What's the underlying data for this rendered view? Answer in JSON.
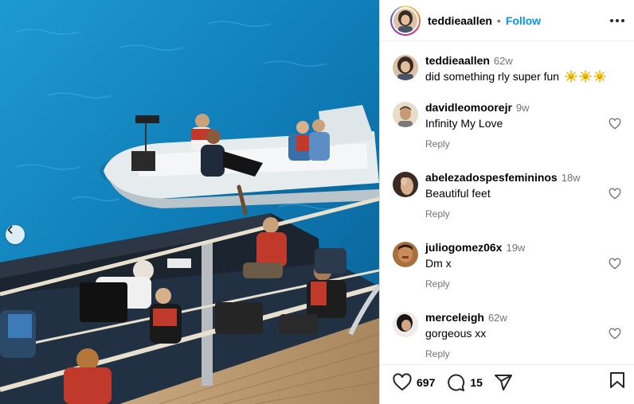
{
  "post": {
    "author": "teddieaallen",
    "follow_label": "Follow",
    "separator": "•",
    "caption": {
      "username": "teddieaallen",
      "time": "62w",
      "text": "did something rly super fun",
      "emoji": [
        "sun-with-face",
        "sun-with-face",
        "sun-with-face"
      ]
    }
  },
  "comments": [
    {
      "username": "davidleomoorejr",
      "time": "9w",
      "text": "Infinity My Love",
      "reply_label": "Reply"
    },
    {
      "username": "abelezadospesfemininos",
      "time": "18w",
      "text": "Beautiful feet",
      "reply_label": "Reply"
    },
    {
      "username": "juliogomez06x",
      "time": "19w",
      "text": "Dm x",
      "reply_label": "Reply"
    },
    {
      "username": "merceleigh",
      "time": "62w",
      "text": "gorgeous xx",
      "reply_label": "Reply"
    }
  ],
  "actions": {
    "likes": "697",
    "comments": "15"
  },
  "icons": {
    "carousel_prev": "chevron-left-icon",
    "more": "more-horizontal-icon",
    "like": "heart-icon",
    "comment": "comment-bubble-icon",
    "share": "send-icon",
    "save": "bookmark-icon"
  },
  "colors": {
    "follow": "#0095f6",
    "muted": "#737373",
    "sea": "#0e79b3"
  }
}
